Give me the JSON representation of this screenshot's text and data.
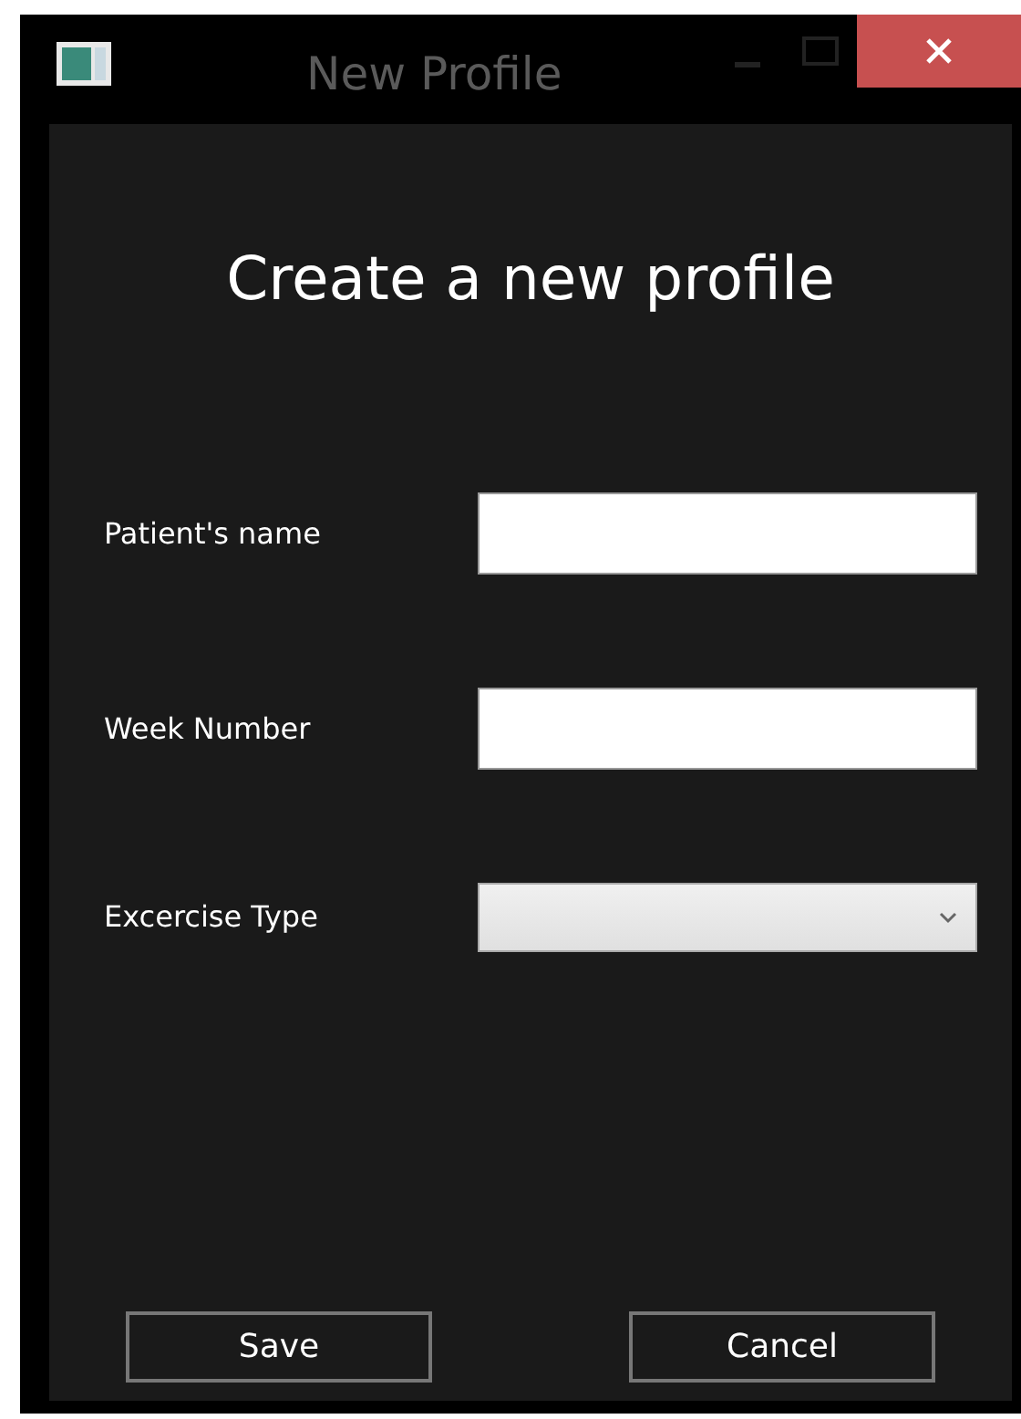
{
  "window": {
    "title": "New Profile"
  },
  "heading": "Create a new profile",
  "fields": [
    {
      "label": "Patient's name",
      "kind": "text"
    },
    {
      "label": "Week Number",
      "kind": "text"
    },
    {
      "label": "Excercise Type",
      "kind": "dropdown"
    }
  ],
  "buttons": [
    "Save",
    "Cancel"
  ]
}
